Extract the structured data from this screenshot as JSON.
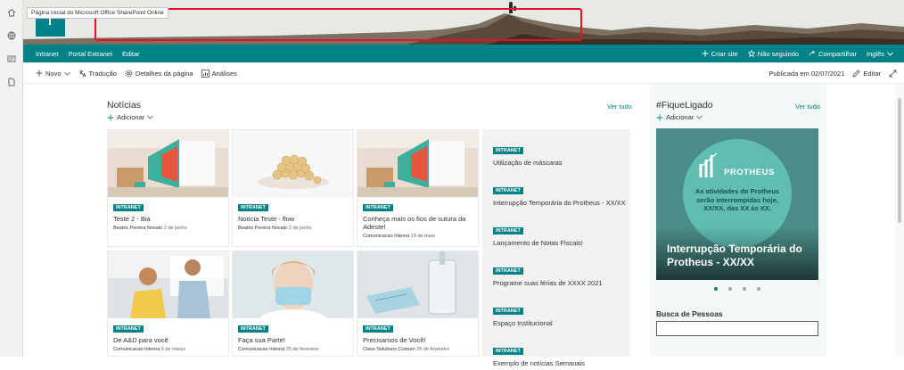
{
  "banner": {
    "tooltip": "Página inicial do Microsoft Office SharePoint Online"
  },
  "suitebar": {
    "nav": [
      "Intranet",
      "Portal Extranet",
      "Editar"
    ],
    "right": [
      "Criar site",
      "Não seguindo",
      "Compartilhar",
      "Inglês"
    ]
  },
  "cmdbar": {
    "new": "Novo",
    "translation": "Tradução",
    "page_details": "Detalhes da página",
    "analytics": "Análises",
    "published": "Publicada em 02/07/2021",
    "edit": "Editar"
  },
  "news": {
    "title": "Notícias",
    "see_all": "Ver tudo",
    "add": "Adicionar",
    "cards": [
      {
        "badge": "INTRANET",
        "title": "Teste 2 - Bia",
        "author": "Beatriz Pereira Novato",
        "date": "2 de junho"
      },
      {
        "badge": "INTRANET",
        "title": "Notícia Teste - flow",
        "author": "Beatriz Pereira Novato",
        "date": "2 de junho"
      },
      {
        "badge": "INTRANET",
        "title": "Conheça mais os fios de sutura da Adeste!",
        "author": "Comunicacao Interna",
        "date": "19 de maio"
      },
      {
        "badge": "INTRANET",
        "title": "De A&D para você",
        "author": "Comunicacao Interna",
        "date": "5 de março"
      },
      {
        "badge": "INTRANET",
        "title": "Faça sua Parte!",
        "author": "Comunicacao Interna",
        "date": "25 de fevereiro"
      },
      {
        "badge": "INTRANET",
        "title": "Precisamos de Você!",
        "author": "Class Solutions Comum",
        "date": "25 de fevereiro"
      }
    ],
    "list": [
      {
        "badge": "INTRANET",
        "title": "Utilização de máscaras"
      },
      {
        "badge": "INTRANET",
        "title": "Interrupção Temporária do Protheus - XX/XX"
      },
      {
        "badge": "INTRANET",
        "title": "Lançamento de Notas Fiscais!"
      },
      {
        "badge": "INTRANET",
        "title": "Programe suas férias de XXXX 2021"
      },
      {
        "badge": "INTRANET",
        "title": "Espaço Institucional"
      },
      {
        "badge": "INTRANET",
        "title": "Exemplo de notícias Semanais"
      }
    ]
  },
  "side": {
    "title": "#FiqueLigado",
    "see_all": "Ver tudo",
    "add": "Adicionar",
    "carousel": {
      "brand": "PROTHEUS",
      "image_text": "As atividades do Protheus serão interrompidas hoje, XX/XX, das XX às XX.",
      "caption": "Interrupção Temporária do Protheus - XX/XX",
      "slides": 4,
      "active": 1
    },
    "people_title": "Busca de Pessoas"
  },
  "colors": {
    "accent": "#038387"
  }
}
